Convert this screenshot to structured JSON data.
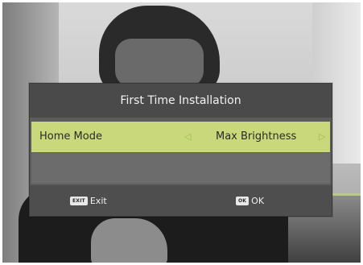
{
  "dialog": {
    "title": "First Time Installation",
    "option": {
      "label": "Home Mode",
      "left_arrow": "◁",
      "value": "Max Brightness",
      "right_arrow": "▷"
    },
    "footer": {
      "exit_key": "EXIT",
      "exit_label": "Exit",
      "ok_key": "OK",
      "ok_label": "OK"
    }
  },
  "colors": {
    "title_bar": "#4a4a4a",
    "dialog_body": "#5c5c5c",
    "highlight_row": "#c9d87a",
    "arrow": "#9dbb55"
  }
}
